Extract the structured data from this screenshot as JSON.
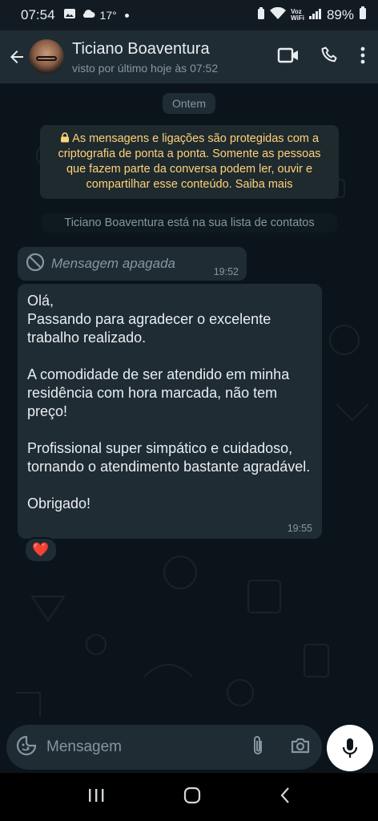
{
  "status_bar": {
    "time": "07:54",
    "temperature": "17°",
    "battery": "89%",
    "network_label_top": "Voz",
    "network_label_bottom": "WiFi"
  },
  "header": {
    "contact_name": "Ticiano Boaventura",
    "last_seen": "visto por último hoje às 07:52"
  },
  "chat": {
    "date_label": "Ontem",
    "encryption_notice": "As mensagens e ligações são protegidas com a criptografia de ponta a ponta. Somente as pessoas que fazem parte da conversa podem ler, ouvir e compartilhar esse conteúdo. Saiba mais",
    "contact_notice": "Ticiano Boaventura está na sua lista de contatos",
    "deleted_message": {
      "text": "Mensagem apagada",
      "time": "19:52"
    },
    "message": {
      "lines": [
        "Olá,",
        "Passando para agradecer o excelente trabalho realizado.",
        "",
        "A comodidade de ser atendido em minha residência com hora marcada, não tem preço!",
        "",
        "Profissional super simpático e cuidadoso, tornando o atendimento bastante agradável.",
        "",
        "Obrigado!"
      ],
      "time": "19:55",
      "reaction": "❤️"
    }
  },
  "composer": {
    "placeholder": "Mensagem"
  },
  "colors": {
    "background": "#0b141a",
    "header": "#1f2c34",
    "bubble": "#1f2c34",
    "notice_text": "#ffd279",
    "secondary_text": "#8696a0"
  }
}
